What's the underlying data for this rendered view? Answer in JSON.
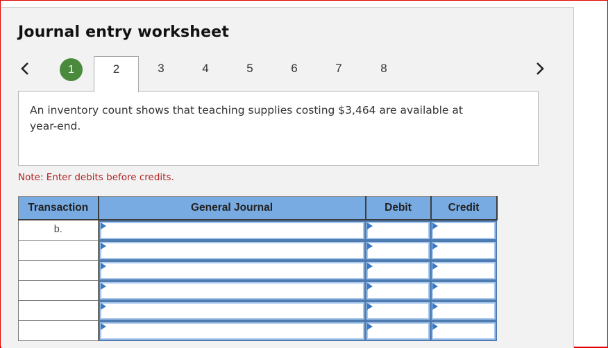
{
  "title": "Journal entry worksheet",
  "nav": {
    "prev_icon": "chevron-left-icon",
    "next_icon": "chevron-right-icon",
    "steps": [
      {
        "label": "1",
        "state": "completed"
      },
      {
        "label": "2",
        "state": "active"
      },
      {
        "label": "3",
        "state": "default"
      },
      {
        "label": "4",
        "state": "default"
      },
      {
        "label": "5",
        "state": "default"
      },
      {
        "label": "6",
        "state": "default"
      },
      {
        "label": "7",
        "state": "default"
      },
      {
        "label": "8",
        "state": "default"
      }
    ]
  },
  "description": "An inventory count shows that teaching supplies costing $3,464 are available at year-end.",
  "note": "Note: Enter debits before credits.",
  "table": {
    "headers": {
      "transaction": "Transaction",
      "general_journal": "General Journal",
      "debit": "Debit",
      "credit": "Credit"
    },
    "rows": [
      {
        "transaction": "b.",
        "account": "",
        "debit": "",
        "credit": ""
      },
      {
        "transaction": "",
        "account": "",
        "debit": "",
        "credit": ""
      },
      {
        "transaction": "",
        "account": "",
        "debit": "",
        "credit": ""
      },
      {
        "transaction": "",
        "account": "",
        "debit": "",
        "credit": ""
      },
      {
        "transaction": "",
        "account": "",
        "debit": "",
        "credit": ""
      },
      {
        "transaction": "",
        "account": "",
        "debit": "",
        "credit": ""
      }
    ]
  },
  "colors": {
    "completed_step": "#4a8a3c",
    "header_bg": "#78abe2",
    "note_text": "#b22222",
    "input_border": "#4f7cb0",
    "dropdown_flag": "#3b78c4"
  }
}
